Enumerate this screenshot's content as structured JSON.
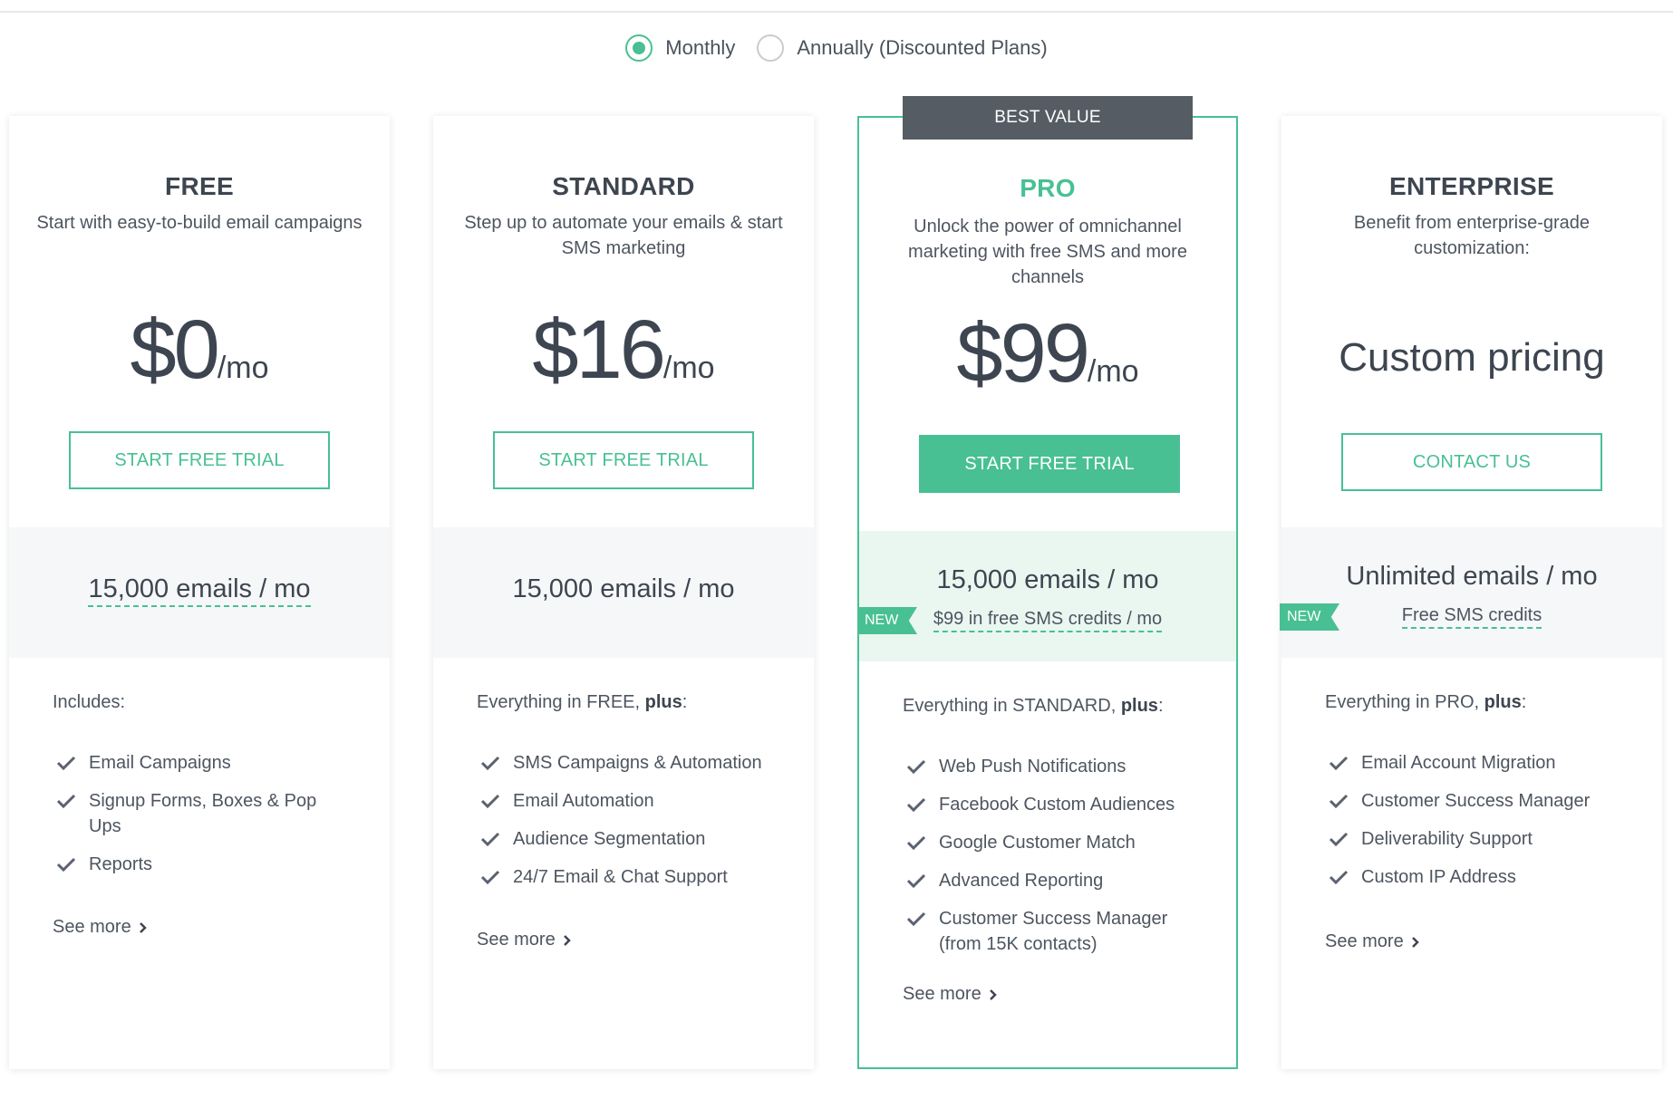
{
  "billing_toggle": {
    "monthly_label": "Monthly",
    "annual_label": "Annually (Discounted Plans)",
    "selected": "Monthly"
  },
  "colors": {
    "accent": "#48c093",
    "dark_badge": "#555c63",
    "text": "#3d4550"
  },
  "best_value_label": "BEST VALUE",
  "plans": [
    {
      "name": "FREE",
      "description": "Start with easy-to-build email campaigns",
      "price_amount": "$0",
      "price_period": "/mo",
      "cta_label": "START FREE TRIAL",
      "emails": "15,000 emails / mo",
      "includes_prefix": "Includes:",
      "includes_bold": "",
      "includes_suffix": "",
      "features": [
        "Email Campaigns",
        "Signup Forms, Boxes & Pop Ups",
        "Reports"
      ],
      "see_more": "See more"
    },
    {
      "name": "STANDARD",
      "description": "Step up to automate your emails & start SMS marketing",
      "price_amount": "$16",
      "price_period": "/mo",
      "cta_label": "START FREE TRIAL",
      "emails": "15,000 emails / mo",
      "includes_prefix": "Everything in FREE, ",
      "includes_bold": "plus",
      "includes_suffix": ":",
      "features": [
        "SMS Campaigns & Automation",
        "Email Automation",
        "Audience Segmentation",
        "24/7 Email & Chat Support"
      ],
      "see_more": "See more"
    },
    {
      "name": "PRO",
      "description": "Unlock the power of omnichannel marketing with free SMS and more channels",
      "price_amount": "$99",
      "price_period": "/mo",
      "cta_label": "START FREE TRIAL",
      "emails": "15,000 emails / mo",
      "new_tag": "NEW",
      "sms_credits": "$99 in free SMS credits / mo",
      "includes_prefix": "Everything in STANDARD, ",
      "includes_bold": "plus",
      "includes_suffix": ":",
      "features": [
        "Web Push Notifications",
        "Facebook Custom Audiences",
        "Google Customer Match",
        "Advanced Reporting",
        "Customer Success Manager (from 15K contacts)"
      ],
      "see_more": "See more"
    },
    {
      "name": "ENTERPRISE",
      "description": "Benefit from enterprise-grade customization:",
      "custom_price": "Custom pricing",
      "cta_label": "CONTACT US",
      "emails": "Unlimited emails / mo",
      "new_tag": "NEW",
      "sms_credits": "Free SMS credits",
      "includes_prefix": "Everything in PRO, ",
      "includes_bold": "plus",
      "includes_suffix": ":",
      "features": [
        "Email Account Migration",
        "Customer Success Manager",
        "Deliverability Support",
        "Custom IP Address"
      ],
      "see_more": "See more"
    }
  ]
}
